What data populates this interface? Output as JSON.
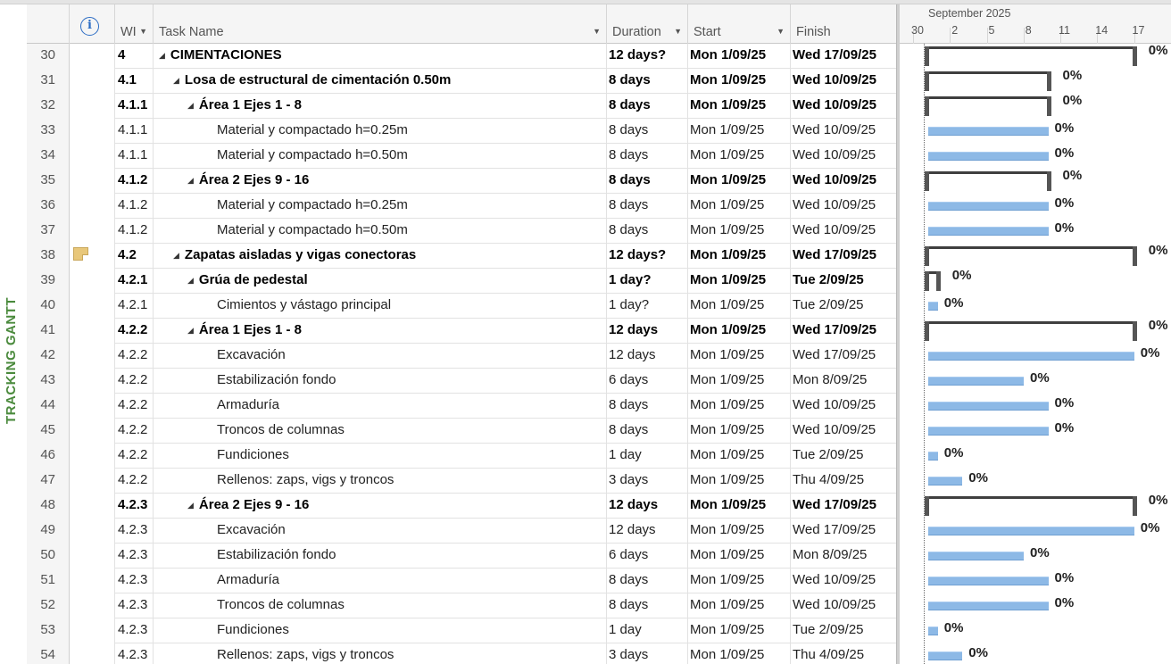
{
  "view": {
    "label": "TRACKING GANTT"
  },
  "columns": {
    "wi": "WI",
    "task_name": "Task Name",
    "duration": "Duration",
    "start": "Start",
    "finish": "Finish"
  },
  "timescale": {
    "month": "September 2025",
    "ticks": [
      "30",
      "2",
      "5",
      "8",
      "11",
      "14",
      "17",
      "2"
    ]
  },
  "rows": [
    {
      "id": "30",
      "wi": "4",
      "name": "CIMENTACIONES",
      "duration": "12 days?",
      "start": "Mon 1/09/25",
      "finish": "Wed 17/09/25",
      "level": 0,
      "summary": true,
      "start_day": 1,
      "days": 17,
      "pct": "0%"
    },
    {
      "id": "31",
      "wi": "4.1",
      "name": "Losa de estructural de cimentación 0.50m",
      "duration": "8 days",
      "start": "Mon 1/09/25",
      "finish": "Wed 10/09/25",
      "level": 1,
      "summary": true,
      "start_day": 1,
      "days": 10,
      "pct": "0%"
    },
    {
      "id": "32",
      "wi": "4.1.1",
      "name": "Área 1 Ejes 1 - 8",
      "duration": "8 days",
      "start": "Mon 1/09/25",
      "finish": "Wed 10/09/25",
      "level": 2,
      "summary": true,
      "start_day": 1,
      "days": 10,
      "pct": "0%"
    },
    {
      "id": "33",
      "wi": "4.1.1",
      "name": "Material y compactado h=0.25m",
      "duration": "8 days",
      "start": "Mon 1/09/25",
      "finish": "Wed 10/09/25",
      "level": 3,
      "summary": false,
      "start_day": 1,
      "days": 10,
      "pct": "0%"
    },
    {
      "id": "34",
      "wi": "4.1.1",
      "name": "Material y compactado h=0.50m",
      "duration": "8 days",
      "start": "Mon 1/09/25",
      "finish": "Wed 10/09/25",
      "level": 3,
      "summary": false,
      "start_day": 1,
      "days": 10,
      "pct": "0%"
    },
    {
      "id": "35",
      "wi": "4.1.2",
      "name": "Área 2 Ejes 9 - 16",
      "duration": "8 days",
      "start": "Mon 1/09/25",
      "finish": "Wed 10/09/25",
      "level": 2,
      "summary": true,
      "start_day": 1,
      "days": 10,
      "pct": "0%"
    },
    {
      "id": "36",
      "wi": "4.1.2",
      "name": "Material y compactado h=0.25m",
      "duration": "8 days",
      "start": "Mon 1/09/25",
      "finish": "Wed 10/09/25",
      "level": 3,
      "summary": false,
      "start_day": 1,
      "days": 10,
      "pct": "0%"
    },
    {
      "id": "37",
      "wi": "4.1.2",
      "name": "Material y compactado h=0.50m",
      "duration": "8 days",
      "start": "Mon 1/09/25",
      "finish": "Wed 10/09/25",
      "level": 3,
      "summary": false,
      "start_day": 1,
      "days": 10,
      "pct": "0%"
    },
    {
      "id": "38",
      "wi": "4.2",
      "name": "Zapatas aisladas y vigas conectoras",
      "duration": "12 days?",
      "start": "Mon 1/09/25",
      "finish": "Wed 17/09/25",
      "level": 1,
      "summary": true,
      "start_day": 1,
      "days": 17,
      "pct": "0%",
      "note": true
    },
    {
      "id": "39",
      "wi": "4.2.1",
      "name": "Grúa de pedestal",
      "duration": "1 day?",
      "start": "Mon 1/09/25",
      "finish": "Tue 2/09/25",
      "level": 2,
      "summary": true,
      "start_day": 1,
      "days": 1,
      "pct": "0%"
    },
    {
      "id": "40",
      "wi": "4.2.1",
      "name": "Cimientos y vástago principal",
      "duration": "1 day?",
      "start": "Mon 1/09/25",
      "finish": "Tue 2/09/25",
      "level": 3,
      "summary": false,
      "start_day": 1,
      "days": 1,
      "pct": "0%"
    },
    {
      "id": "41",
      "wi": "4.2.2",
      "name": "Área 1 Ejes 1 - 8",
      "duration": "12 days",
      "start": "Mon 1/09/25",
      "finish": "Wed 17/09/25",
      "level": 2,
      "summary": true,
      "start_day": 1,
      "days": 17,
      "pct": "0%"
    },
    {
      "id": "42",
      "wi": "4.2.2",
      "name": "Excavación",
      "duration": "12 days",
      "start": "Mon 1/09/25",
      "finish": "Wed 17/09/25",
      "level": 3,
      "summary": false,
      "start_day": 1,
      "days": 17,
      "pct": "0%"
    },
    {
      "id": "43",
      "wi": "4.2.2",
      "name": "Estabilización fondo",
      "duration": "6 days",
      "start": "Mon 1/09/25",
      "finish": "Mon 8/09/25",
      "level": 3,
      "summary": false,
      "start_day": 1,
      "days": 8,
      "pct": "0%"
    },
    {
      "id": "44",
      "wi": "4.2.2",
      "name": "Armaduría",
      "duration": "8 days",
      "start": "Mon 1/09/25",
      "finish": "Wed 10/09/25",
      "level": 3,
      "summary": false,
      "start_day": 1,
      "days": 10,
      "pct": "0%"
    },
    {
      "id": "45",
      "wi": "4.2.2",
      "name": "Troncos de columnas",
      "duration": "8 days",
      "start": "Mon 1/09/25",
      "finish": "Wed 10/09/25",
      "level": 3,
      "summary": false,
      "start_day": 1,
      "days": 10,
      "pct": "0%"
    },
    {
      "id": "46",
      "wi": "4.2.2",
      "name": "Fundiciones",
      "duration": "1 day",
      "start": "Mon 1/09/25",
      "finish": "Tue 2/09/25",
      "level": 3,
      "summary": false,
      "start_day": 1,
      "days": 1,
      "pct": "0%"
    },
    {
      "id": "47",
      "wi": "4.2.2",
      "name": "Rellenos: zaps, vigs y troncos",
      "duration": "3 days",
      "start": "Mon 1/09/25",
      "finish": "Thu 4/09/25",
      "level": 3,
      "summary": false,
      "start_day": 1,
      "days": 3,
      "pct": "0%"
    },
    {
      "id": "48",
      "wi": "4.2.3",
      "name": "Área 2 Ejes 9 - 16",
      "duration": "12 days",
      "start": "Mon 1/09/25",
      "finish": "Wed 17/09/25",
      "level": 2,
      "summary": true,
      "start_day": 1,
      "days": 17,
      "pct": "0%"
    },
    {
      "id": "49",
      "wi": "4.2.3",
      "name": "Excavación",
      "duration": "12 days",
      "start": "Mon 1/09/25",
      "finish": "Wed 17/09/25",
      "level": 3,
      "summary": false,
      "start_day": 1,
      "days": 17,
      "pct": "0%"
    },
    {
      "id": "50",
      "wi": "4.2.3",
      "name": "Estabilización fondo",
      "duration": "6 days",
      "start": "Mon 1/09/25",
      "finish": "Mon 8/09/25",
      "level": 3,
      "summary": false,
      "start_day": 1,
      "days": 8,
      "pct": "0%"
    },
    {
      "id": "51",
      "wi": "4.2.3",
      "name": "Armaduría",
      "duration": "8 days",
      "start": "Mon 1/09/25",
      "finish": "Wed 10/09/25",
      "level": 3,
      "summary": false,
      "start_day": 1,
      "days": 10,
      "pct": "0%"
    },
    {
      "id": "52",
      "wi": "4.2.3",
      "name": "Troncos de columnas",
      "duration": "8 days",
      "start": "Mon 1/09/25",
      "finish": "Wed 10/09/25",
      "level": 3,
      "summary": false,
      "start_day": 1,
      "days": 10,
      "pct": "0%"
    },
    {
      "id": "53",
      "wi": "4.2.3",
      "name": "Fundiciones",
      "duration": "1 day",
      "start": "Mon 1/09/25",
      "finish": "Tue 2/09/25",
      "level": 3,
      "summary": false,
      "start_day": 1,
      "days": 1,
      "pct": "0%"
    },
    {
      "id": "54",
      "wi": "4.2.3",
      "name": "Rellenos: zaps, vigs y troncos",
      "duration": "3 days",
      "start": "Mon 1/09/25",
      "finish": "Thu 4/09/25",
      "level": 3,
      "summary": false,
      "start_day": 1,
      "days": 3,
      "pct": "0%"
    }
  ],
  "colors": {
    "task_bar": "#8db9e6",
    "summary_bar": "#3f3f3f",
    "view_label": "#4a8a3c",
    "info_icon": "#2b6cc4"
  },
  "icons": {
    "indicator_header": "info-icon",
    "note": "note-icon",
    "collapse": "collapse-triangle-icon"
  }
}
